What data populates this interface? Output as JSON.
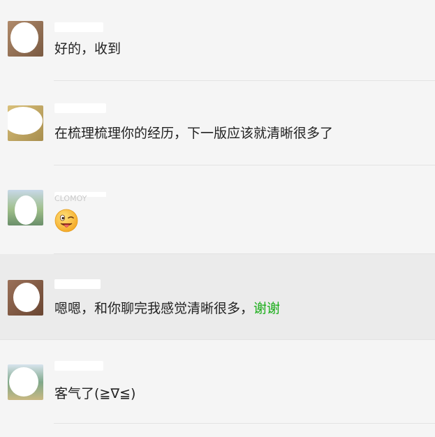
{
  "messages": [
    {
      "text": "好的，收到",
      "avatar": {
        "colors": [
          "#b08a6a",
          "#7a5a42"
        ]
      }
    },
    {
      "text": "在梳理梳理你的经历，下一版应该就清晰很多了",
      "avatar": {
        "colors": [
          "#d9c07a",
          "#a88e4e"
        ]
      }
    },
    {
      "sender_fragment": "CLOMOY",
      "emoji": "winking-face-with-tongue",
      "avatar": {
        "colors": [
          "#9fbf8a",
          "#6a8f6a"
        ]
      }
    },
    {
      "text_main": "嗯嗯，和你聊完我感觉清晰很多，",
      "text_link": "谢谢",
      "avatar": {
        "colors": [
          "#9a7058",
          "#6a4632"
        ]
      }
    },
    {
      "text": "客气了(≧∇≦)",
      "avatar": {
        "colors": [
          "#7fa88a",
          "#c9b882"
        ]
      }
    }
  ],
  "colors": {
    "background": "#f5f5f5",
    "highlight": "#ebebeb",
    "divider": "#e3e3e3",
    "text": "#222222",
    "link": "#1aad19"
  }
}
